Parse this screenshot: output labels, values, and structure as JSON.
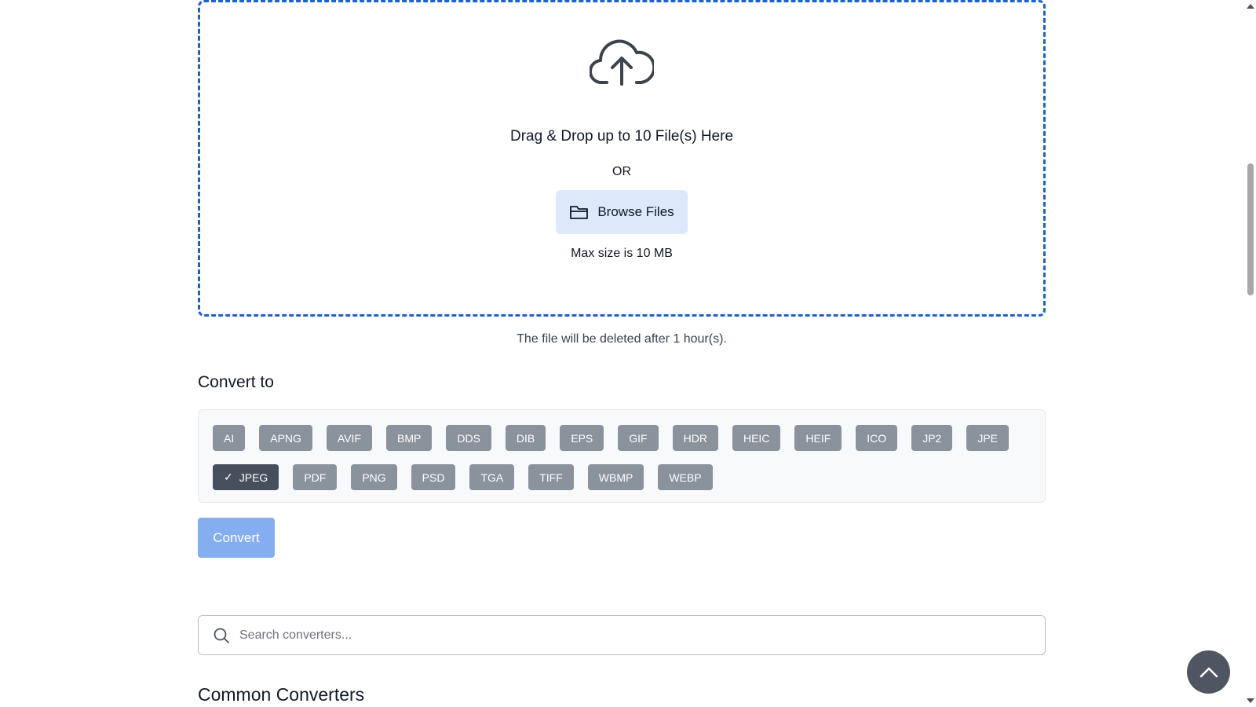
{
  "dropzone": {
    "icon": "cloud-upload-icon",
    "title": "Drag & Drop up to 10 File(s) Here",
    "or_text": "OR",
    "browse_label": "Browse Files",
    "browse_icon": "folder-icon",
    "max_size": "Max size is 10 MB"
  },
  "delete_note": "The file will be deleted after 1 hour(s).",
  "convert_section": {
    "heading": "Convert to",
    "formats_row1": [
      "AI",
      "APNG",
      "AVIF",
      "BMP",
      "DDS",
      "DIB",
      "EPS",
      "GIF",
      "HDR",
      "HEIC",
      "HEIF",
      "ICO",
      "JP2",
      "JPE"
    ],
    "formats_row2": [
      "JPEG",
      "PDF",
      "PNG",
      "PSD",
      "TGA",
      "TIFF",
      "WBMP",
      "WEBP"
    ],
    "selected_format": "JPEG",
    "convert_label": "Convert"
  },
  "search": {
    "placeholder": "Search converters...",
    "value": "",
    "icon": "search-icon"
  },
  "common_heading": "Common Converters",
  "back_to_top_icon": "chevron-up-icon",
  "colors": {
    "dropzone_border": "#1e63c4",
    "browse_bg": "#dde8fb",
    "format_chip": "#8a929c",
    "format_chip_selected": "#464f5b",
    "convert_button": "#85aef0",
    "back_to_top": "#4f5662"
  }
}
